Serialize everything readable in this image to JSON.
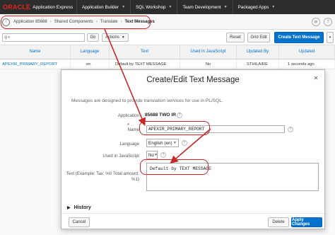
{
  "topbar": {
    "logo_brand": "ORACLE",
    "logo_product": "Application Express",
    "tabs": [
      {
        "label": "Application Builder"
      },
      {
        "label": "SQL Workshop"
      },
      {
        "label": "Team Development"
      },
      {
        "label": "Packaged Apps"
      }
    ]
  },
  "breadcrumb": {
    "items": [
      "Application 85688",
      "Shared Components",
      "Translate",
      "Text Messages"
    ]
  },
  "toolbar": {
    "go_label": "Go",
    "actions_label": "Actions",
    "reset_label": "Reset",
    "grid_edit_label": "Grid Edit",
    "create_label": "Create Text Message"
  },
  "report": {
    "columns": [
      "Name",
      "Language",
      "Text",
      "Used in JavaScript",
      "Updated By",
      "Updated"
    ],
    "rows": [
      {
        "name": "APEXIR_PRIMARY_REPORT",
        "language": "en",
        "text": "Default by TEXT MESSAGE",
        "used_in_js": "No",
        "updated_by": "STHILAIRE",
        "updated": "1 seconds ago"
      }
    ]
  },
  "dialog": {
    "title": "Create/Edit Text Message",
    "description": "Messages are designed to provide translation services for use in PL/SQL.",
    "application_label": "Application",
    "application_value": "85688 TWO IR",
    "name_label": "Name",
    "name_value": "APEXIR_PRIMARY_REPORT",
    "language_label": "Language",
    "language_value": "English (en)",
    "used_in_js_label": "Used in JavaScript",
    "used_in_js_value": "No",
    "text_label_1": "Text (Example: Tax: %0 Total amount:",
    "text_label_2": "%1)",
    "text_value": "Default by TEXT MESSAGE",
    "history_label": "History",
    "cancel_label": "Cancel",
    "delete_label": "Delete",
    "apply_label": "Apply Changes"
  },
  "colors": {
    "primary": "#0572ce",
    "annotation": "#c62828",
    "topbar": "#2d2d2d"
  }
}
